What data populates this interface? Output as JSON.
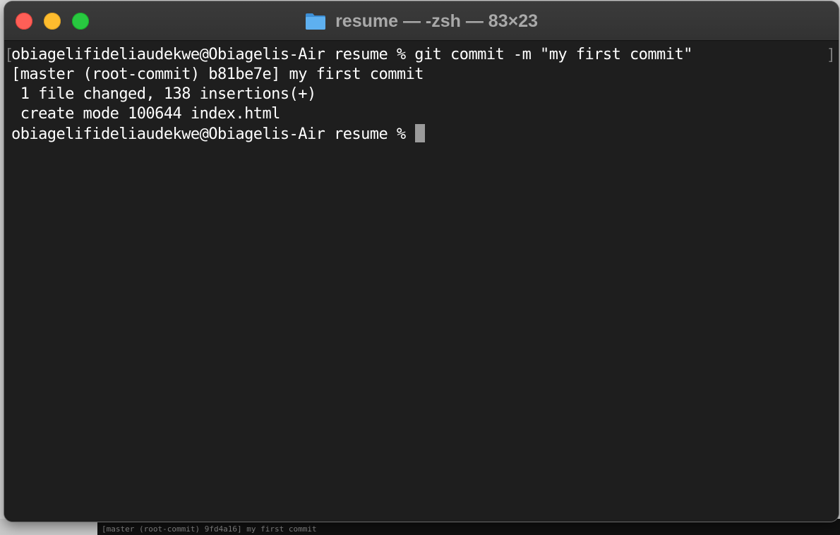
{
  "window": {
    "title": "resume — -zsh — 83×23",
    "folder_icon": "folder-icon",
    "traffic_lights": {
      "close_color": "#ff5f57",
      "minimize_color": "#febc2e",
      "zoom_color": "#28c840"
    }
  },
  "terminal": {
    "background": "#1e1e1e",
    "foreground": "#ffffff",
    "lines": [
      "obiagelifideliaudekwe@Obiagelis-Air resume % git commit -m \"my first commit\"",
      "[master (root-commit) b81be7e] my first commit",
      " 1 file changed, 138 insertions(+)",
      " create mode 100644 index.html"
    ],
    "prompt": "obiagelifideliaudekwe@Obiagelis-Air resume %",
    "mark_left": "[",
    "mark_right": "]"
  },
  "background_window": {
    "lines": [
      "[master (root-commit) 9fd4a16] my first commit"
    ]
  }
}
